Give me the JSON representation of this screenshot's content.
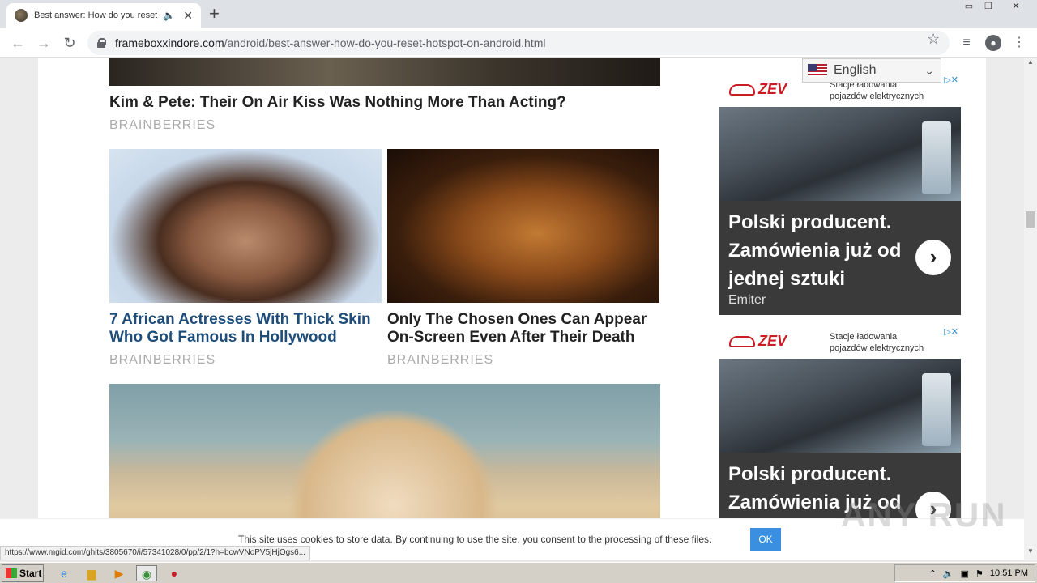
{
  "browser": {
    "tab_title": "Best answer: How do you reset",
    "url_domain": "frameboxxindore.com",
    "url_path": "/android/best-answer-how-do-you-reset-hotspot-on-android.html",
    "status_url": "https://www.mgid.com/ghits/3805670/i/57341028/0/pp/2/1?h=bcwVNoPV5jHjOgs6..."
  },
  "article": {
    "headline": "Kim & Pete: Their On Air Kiss Was Nothing More Than Acting?",
    "headline_source": "BRAINBERRIES",
    "cards": [
      {
        "title": "7 African Actresses With Thick Skin Who Got Famous In Hollywood",
        "source": "BRAINBERRIES"
      },
      {
        "title": "Only The Chosen Ones Can Appear On-Screen Even After Their Death",
        "source": "BRAINBERRIES"
      }
    ]
  },
  "translate": {
    "language": "English"
  },
  "ads": [
    {
      "logo": "ZEV",
      "tagline_1": "Stacje ładowania",
      "tagline_2": "pojazdów elektrycznych",
      "text": "Polski producent. Zamówienia już od jednej sztuki",
      "brand": "Emiter"
    },
    {
      "logo": "ZEV",
      "tagline_1": "Stacje ładowania",
      "tagline_2": "pojazdów elektrycznych",
      "text": "Polski producent. Zamówienia już od"
    }
  ],
  "cookie": {
    "message": "This site uses cookies to store data. By continuing to use the site, you consent to the processing of these files.",
    "ok_label": "OK"
  },
  "taskbar": {
    "start_label": "Start",
    "clock": "10:51 PM"
  },
  "watermark": "ANY RUN"
}
